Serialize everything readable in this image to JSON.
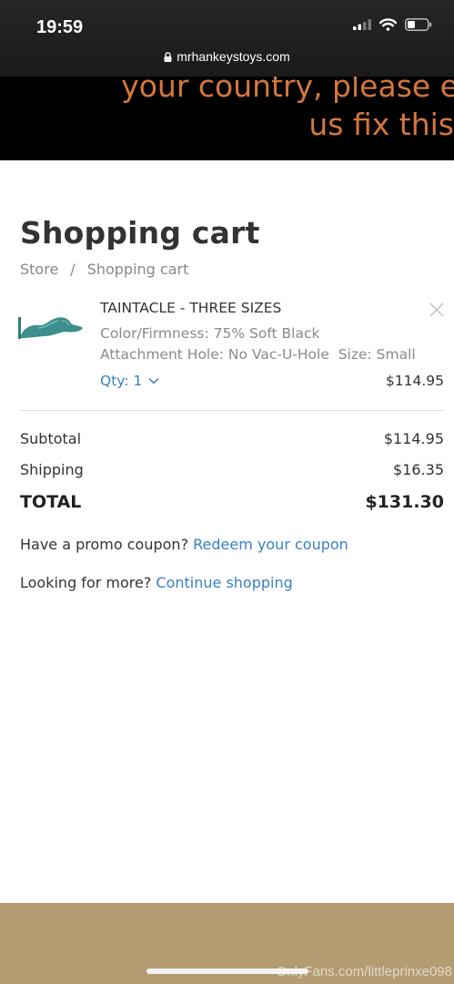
{
  "status_bar": {
    "time": "19:59",
    "url": "mrhankeystoys.com"
  },
  "banner": {
    "line1": "your country, please e",
    "line2": "us fix this"
  },
  "page": {
    "title": "Shopping cart",
    "breadcrumb": [
      "Store",
      "Shopping cart"
    ],
    "breadcrumb_separator": "/"
  },
  "cart": {
    "items": [
      {
        "name": "TAINTACLE - THREE SIZES",
        "color_firmness": "Color/Firmness: 75% Soft Black",
        "attachment_size": "Attachment Hole: No Vac-U-Hole  Size: Small",
        "qty_label": "Qty: 1",
        "price": "$114.95",
        "image_color": "#3c8f8c"
      }
    ]
  },
  "summary": {
    "subtotal_label": "Subtotal",
    "subtotal_value": "$114.95",
    "shipping_label": "Shipping",
    "shipping_value": "$16.35",
    "total_label": "TOTAL",
    "total_value": "$131.30"
  },
  "promo": {
    "text": "Have a promo coupon?",
    "link": "Redeem your coupon"
  },
  "more": {
    "text": "Looking for more?",
    "link": "Continue shopping"
  },
  "watermark": "OnlyFans.com/littleprinxe098",
  "colors": {
    "link": "#3a7fc1",
    "banner_text": "#d4773e",
    "footer": "#b39c72"
  }
}
